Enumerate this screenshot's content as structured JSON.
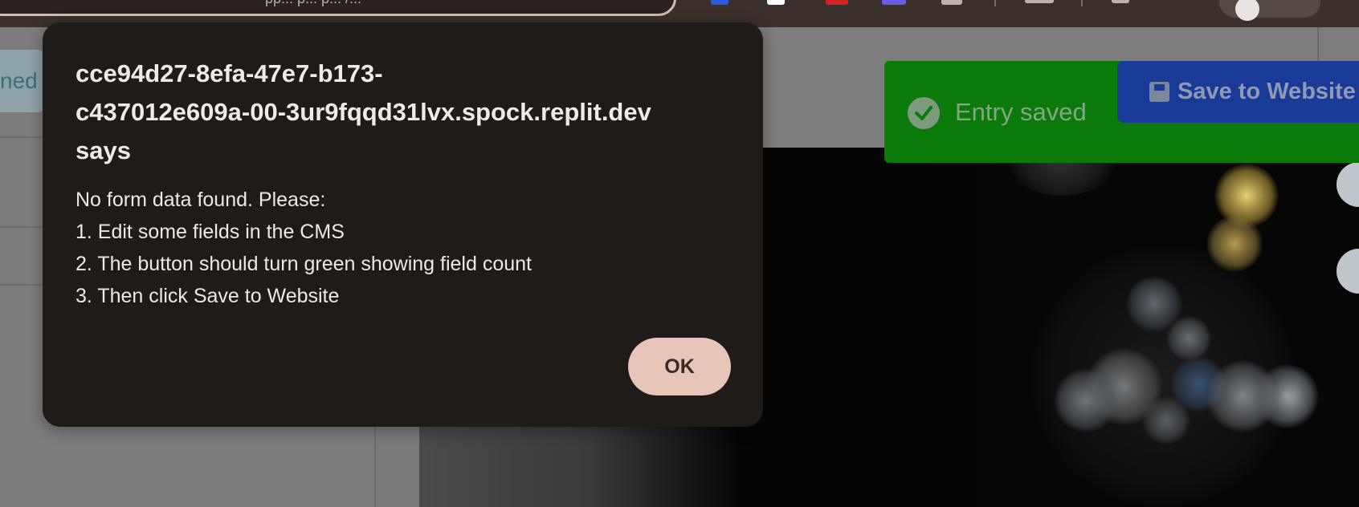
{
  "browser": {
    "url_fragment": "pp... p... p... /...",
    "extensions": [
      {
        "name": "extension-1-icon",
        "color": "#2b5be0"
      },
      {
        "name": "extension-2-icon",
        "color": "#ffffff"
      },
      {
        "name": "extension-3-icon",
        "color": "#d42222"
      },
      {
        "name": "extension-4-icon",
        "color": "#6a5ee8"
      },
      {
        "name": "extension-5-icon",
        "color": "#bdb4b0"
      }
    ]
  },
  "background_app": {
    "partial_tab_label": "ned",
    "toast": {
      "text": "Entry saved",
      "color": "#0a7a0a"
    },
    "save_button": {
      "icon": "floppy-disk-icon",
      "label": "Save to Website",
      "color": "#1a3a98"
    }
  },
  "dialog": {
    "title_line1": "cce94d27-8efa-47e7-b173-",
    "title_line2": "c437012e609a-00-3ur9fqqd31lvx.spock.replit.dev",
    "title_line3": "says",
    "message_lines": [
      "No form data found. Please:",
      "1. Edit some fields in the CMS",
      "2. The button should turn green showing field count",
      "3. Then click Save to Website"
    ],
    "ok_label": "OK",
    "ok_color": "#e7c5b8"
  }
}
